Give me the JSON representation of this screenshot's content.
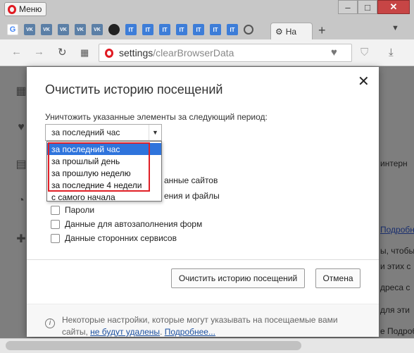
{
  "window": {
    "menu_label": "Меню",
    "min_symbol": "–",
    "max_symbol": "□",
    "close_symbol": "✕"
  },
  "tabs": {
    "favicons": [
      {
        "name": "google-tab-icon",
        "text": "G",
        "cls": "ico-g"
      },
      {
        "name": "vk-tab-icon",
        "text": "VK",
        "cls": "ico-vk"
      },
      {
        "name": "vk-tab-icon",
        "text": "VK",
        "cls": "ico-vk"
      },
      {
        "name": "vk-tab-icon",
        "text": "VK",
        "cls": "ico-vk"
      },
      {
        "name": "vk-tab-icon",
        "text": "VK",
        "cls": "ico-vk"
      },
      {
        "name": "vk-tab-icon",
        "text": "VK",
        "cls": "ico-vk"
      },
      {
        "name": "dark-round-tab-icon",
        "text": "",
        "cls": "ico-dark"
      },
      {
        "name": "it-tab-icon",
        "text": "IT",
        "cls": "ico-it"
      },
      {
        "name": "it-tab-icon",
        "text": "IT",
        "cls": "ico-it"
      },
      {
        "name": "it-tab-icon",
        "text": "IT",
        "cls": "ico-it"
      },
      {
        "name": "it-tab-icon",
        "text": "IT",
        "cls": "ico-it"
      },
      {
        "name": "it-tab-icon",
        "text": "IT",
        "cls": "ico-it"
      },
      {
        "name": "it-tab-icon",
        "text": "IT",
        "cls": "ico-it"
      },
      {
        "name": "it-tab-icon",
        "text": "IT",
        "cls": "ico-it"
      },
      {
        "name": "history-clock-tab-icon",
        "text": "",
        "cls": "ico-clock"
      }
    ],
    "active_label": "На",
    "new_tab_symbol": "+"
  },
  "address_bar": {
    "host": "settings",
    "path": "/clearBrowserData"
  },
  "dialog": {
    "title": "Очистить историю посещений",
    "period_label": "Уничтожить указанные элементы за следующий период:",
    "period_value": "за последний час",
    "period_options": [
      "за последний час",
      "за прошлый день",
      "за прошлую неделю",
      "за последние 4 недели",
      "с самого начала"
    ],
    "checkbox_fragments": {
      "cookies": "анные сайтов",
      "cache": "ения и файлы"
    },
    "checkboxes": [
      "Пароли",
      "Данные для автозаполнения форм",
      "Данные сторонних сервисов"
    ],
    "clear_button": "Очистить историю посещений",
    "cancel_button": "Отмена",
    "footer_text_1": "Некоторые настройки, которые могут указывать на посещаемые вами сайты, ",
    "footer_link_1": "не будут удалены",
    "footer_text_2": ". ",
    "footer_link_2": "Подробнее..."
  },
  "background_fragments": [
    "интерн",
    "Подробн",
    "ы, чтобы",
    "и этих с",
    "дреса с",
    "для эти",
    "е Подроб"
  ]
}
